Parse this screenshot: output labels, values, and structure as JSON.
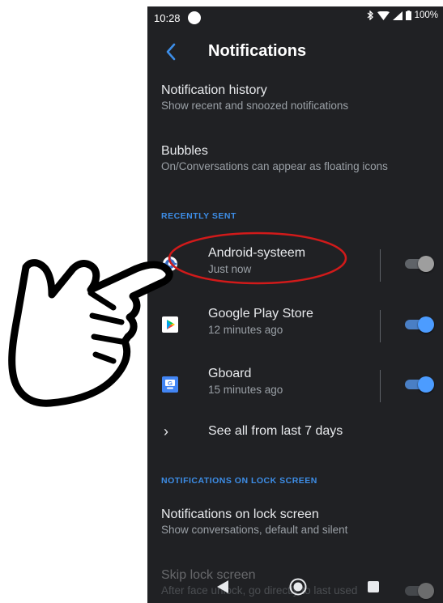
{
  "status_bar": {
    "time": "10:28",
    "battery": "100%"
  },
  "app_bar": {
    "title": "Notifications"
  },
  "notification_history": {
    "title": "Notification history",
    "subtitle": "Show recent and snoozed notifications"
  },
  "bubbles": {
    "title": "Bubbles",
    "subtitle": "On/Conversations can appear as floating icons"
  },
  "recently_sent": {
    "header": "RECENTLY SENT",
    "apps": [
      {
        "name": "Android-systeem",
        "time": "Just now",
        "enabled": false,
        "icon": "settings-gear-icon"
      },
      {
        "name": "Google Play Store",
        "time": "12 minutes ago",
        "enabled": true,
        "icon": "play-store-icon"
      },
      {
        "name": "Gboard",
        "time": "15 minutes ago",
        "enabled": true,
        "icon": "gboard-icon"
      }
    ],
    "see_all": "See all from last 7 days"
  },
  "lock_screen": {
    "header": "NOTIFICATIONS ON LOCK SCREEN",
    "title": "Notifications on lock screen",
    "subtitle": "Show conversations, default and silent"
  },
  "skip_lock": {
    "title": "Skip lock screen",
    "subtitle": "After face unlock, go directly to last used"
  },
  "colors": {
    "background": "#202124",
    "accent": "#3d8ee8",
    "annotation": "#d11a1a"
  }
}
